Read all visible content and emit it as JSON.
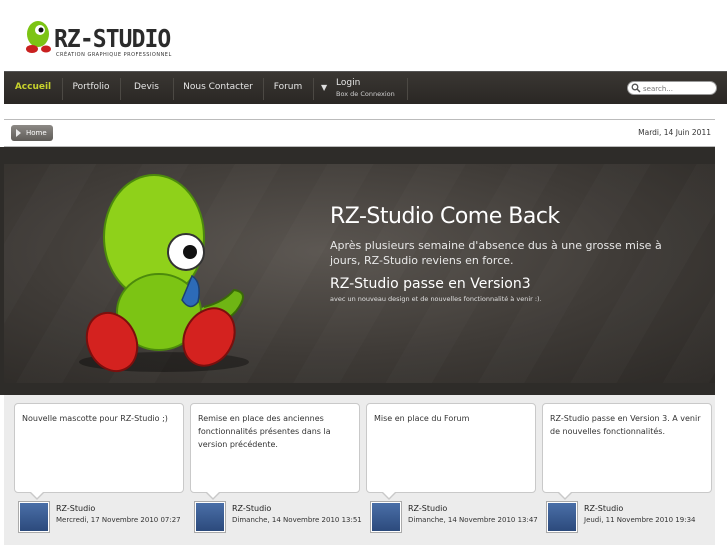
{
  "header": {
    "logo_text": "RZ-STUDIO",
    "tagline": "CRÉATION GRAPHIQUE PROFESSIONNEL"
  },
  "nav": {
    "items": [
      {
        "label": "Accueil",
        "active": true
      },
      {
        "label": "Portfolio"
      },
      {
        "label": "Devis"
      },
      {
        "label": "Nous Contacter"
      },
      {
        "label": "Forum"
      }
    ],
    "login": {
      "label": "Login",
      "sub": "Box de Connexion"
    },
    "search_placeholder": "search..."
  },
  "breadcrumb": {
    "home": "Home"
  },
  "date": "Mardi, 14 Juin 2011",
  "banner": {
    "title": "RZ-Studio Come Back",
    "description": "Après plusieurs semaine d'absence dus à une grosse mise à jours, RZ-Studio reviens en force.",
    "subtitle": "RZ-Studio passe en Version3",
    "note": "avec un nouveau design et de nouvelles fonctionnalité à venir :)."
  },
  "news": [
    {
      "text": "Nouvelle mascotte pour RZ-Studio ;)",
      "author": "RZ-Studio",
      "date": "Mercredi, 17 Novembre 2010 07:27"
    },
    {
      "text": "Remise en place des anciennes fonctionnalités présentes dans la version précédente.",
      "author": "RZ-Studio",
      "date": "Dimanche, 14 Novembre 2010 13:51"
    },
    {
      "text": "Mise en place du Forum",
      "author": "RZ-Studio",
      "date": "Dimanche, 14 Novembre 2010 13:47"
    },
    {
      "text": "RZ-Studio passe en Version 3. A venir de nouvelles fonctionnalités.",
      "author": "RZ-Studio",
      "date": "Jeudi, 11 Novembre 2010 19:34"
    }
  ],
  "colors": {
    "accent": "#c7d22c",
    "nav_bg": "#2f2c29",
    "mascot_green": "#8fd11a"
  }
}
